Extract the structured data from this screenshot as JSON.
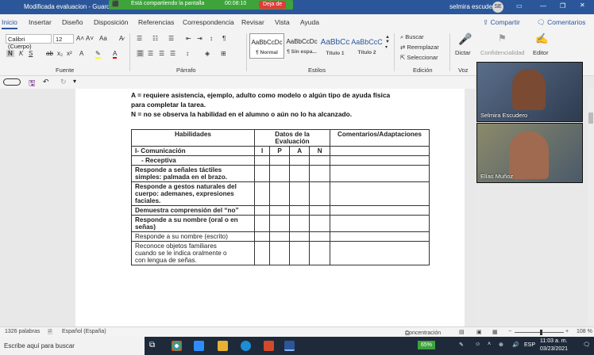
{
  "titlebar": {
    "doc_title": "Modificada evaluacion - Guardad",
    "user": "selmira escudero",
    "avatar": "SE"
  },
  "share_bar": {
    "text": "Está compartiendo la pantalla",
    "timer": "00:08:10",
    "stop": "Deja de"
  },
  "menu": {
    "items": [
      "Inicio",
      "Insertar",
      "Diseño",
      "Disposición",
      "Referencias",
      "Correspondencia",
      "Revisar",
      "Vista",
      "Ayuda"
    ],
    "share": "Compartir",
    "comments": "Comentarios"
  },
  "ribbon": {
    "font_name": "Calibri (Cuerpo)",
    "font_size": "12",
    "groups": {
      "fuente": "Fuente",
      "parrafo": "Párrafo",
      "estilos": "Estilos",
      "edicion": "Edición",
      "voz": "Voz"
    },
    "styles": [
      {
        "sample": "AaBbCcDc",
        "name": "¶ Normal"
      },
      {
        "sample": "AaBbCcDc",
        "name": "¶ Sin espa..."
      },
      {
        "sample": "AaBbCc",
        "name": "Título 1"
      },
      {
        "sample": "AaBbCcC",
        "name": "Título 2"
      }
    ],
    "search": "Buscar",
    "replace": "Reemplazar",
    "select": "Seleccionar",
    "dictate": "Dictar",
    "confidential": "Confidencialidad",
    "editor": "Editor"
  },
  "document": {
    "lines": [
      "A = requiere asistencia, ejemplo, adulto como modelo o algún tipo de ayuda física",
      "para completar la tarea.",
      "N = no se observa la habilidad en el alumno o aún no lo ha alcanzado."
    ],
    "table": {
      "h_skills": "Habilidades",
      "h_data1": "Datos de la",
      "h_data2": "Evaluación",
      "h_comments": "Comentarios/Adaptaciones",
      "cols": [
        "I",
        "P",
        "A",
        "N"
      ],
      "section": "I-  Comunicación",
      "subsection": "- Receptiva",
      "rows": [
        {
          "l1": "Responde a señales táctiles",
          "l2": "simples: palmada en el brazo.",
          "bold": true
        },
        {
          "l1": "Responde a gestos naturales del",
          "l2": "cuerpo: ademanes, expresiones",
          "l3": "faciales.",
          "bold": true
        },
        {
          "l1": "Demuestra comprensión del “no”",
          "bold": true
        },
        {
          "l1": "Responde a su nombre (oral o en",
          "l2": "señas)",
          "bold": true
        },
        {
          "l1": "Responde a su nombre (escrito)",
          "bold": false
        },
        {
          "l1": "Reconoce objetos familiares",
          "l2": "cuando se le indica oralmente o",
          "l3": "con lengua de señas.",
          "bold": false
        }
      ]
    }
  },
  "participants": [
    {
      "name": "Selmira Escudero"
    },
    {
      "name": "Elías Muñoz"
    }
  ],
  "status": {
    "words": "1326 palabras",
    "language": "Español (España)",
    "focus": "Concentración",
    "zoom": "108 %"
  },
  "taskbar": {
    "search": "Escribe aquí para buscar",
    "battery": "65%",
    "lang": "ESP",
    "time": "11:03 a. m.",
    "date": "03/23/2021"
  },
  "colors": {
    "word_blue": "#2b579a",
    "share_green": "#3da33a",
    "taskbar": "#1e2a3a"
  }
}
